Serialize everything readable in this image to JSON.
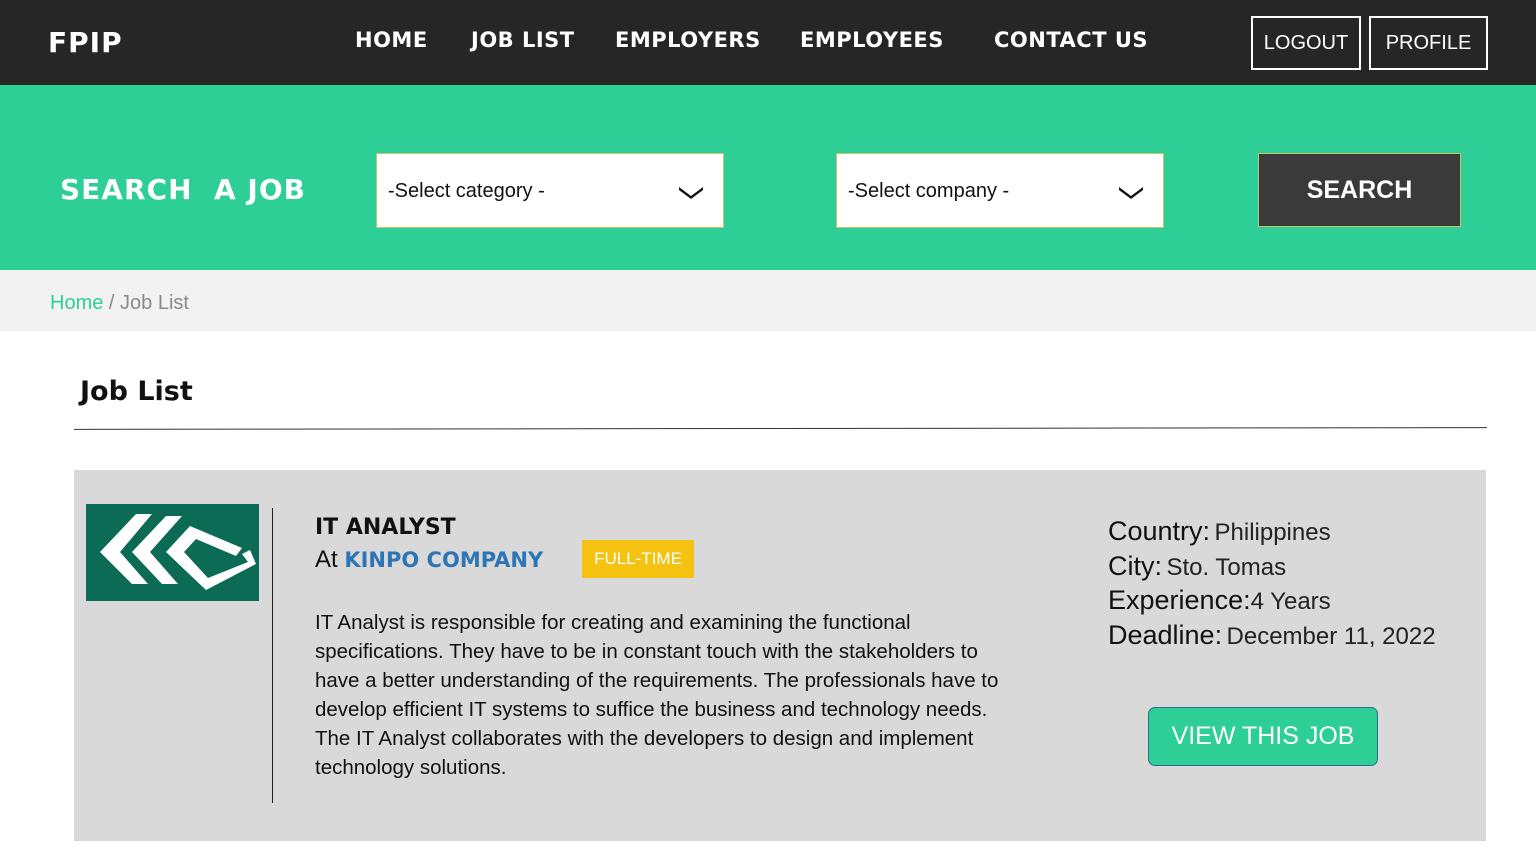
{
  "header": {
    "brand": "FPIP",
    "nav": {
      "home": "HOME",
      "job_list": "JOB LIST",
      "employers": "EMPLOYERS",
      "employees": "EMPLOYEES",
      "contact_us": "CONTACT US"
    },
    "logout_label": "LOGOUT",
    "profile_label": "PROFILE"
  },
  "search": {
    "title": "SEARCH  A JOB",
    "category_selected": "-Select category -",
    "company_selected": "-Select company -",
    "button_label": "SEARCH"
  },
  "breadcrumb": {
    "home": "Home",
    "separator": " / ",
    "current": "Job List"
  },
  "main": {
    "title": "Job List"
  },
  "jobs": [
    {
      "logo_icon": "company-logo-icon",
      "title": "IT ANALYST",
      "at_prefix": "At ",
      "company": "KINPO COMPANY",
      "type": "FULL-TIME",
      "description": "IT Analyst is responsible for creating and examining the functional specifications. They have to be in constant touch with the stakeholders to have a better understanding of the requirements. The professionals have to develop efficient IT systems to suffice the business and technology needs.  The IT Analyst collaborates with the developers to design and implement technology solutions.",
      "country_label": "Country:",
      "country": "Philippines",
      "city_label": "City:",
      "city": "Sto. Tomas",
      "experience_label": "Experience:",
      "experience": "4 Years",
      "deadline_label": "Deadline:",
      "deadline": "December 11, 2022",
      "view_label": "VIEW THIS JOB"
    }
  ],
  "colors": {
    "topbar": "#262626",
    "accent_green": "#2ecf97",
    "company_blue": "#2e75b6",
    "badge_yellow": "#f5c211",
    "card_bg": "#d9d9d9",
    "logo_green": "#0b6b55"
  }
}
